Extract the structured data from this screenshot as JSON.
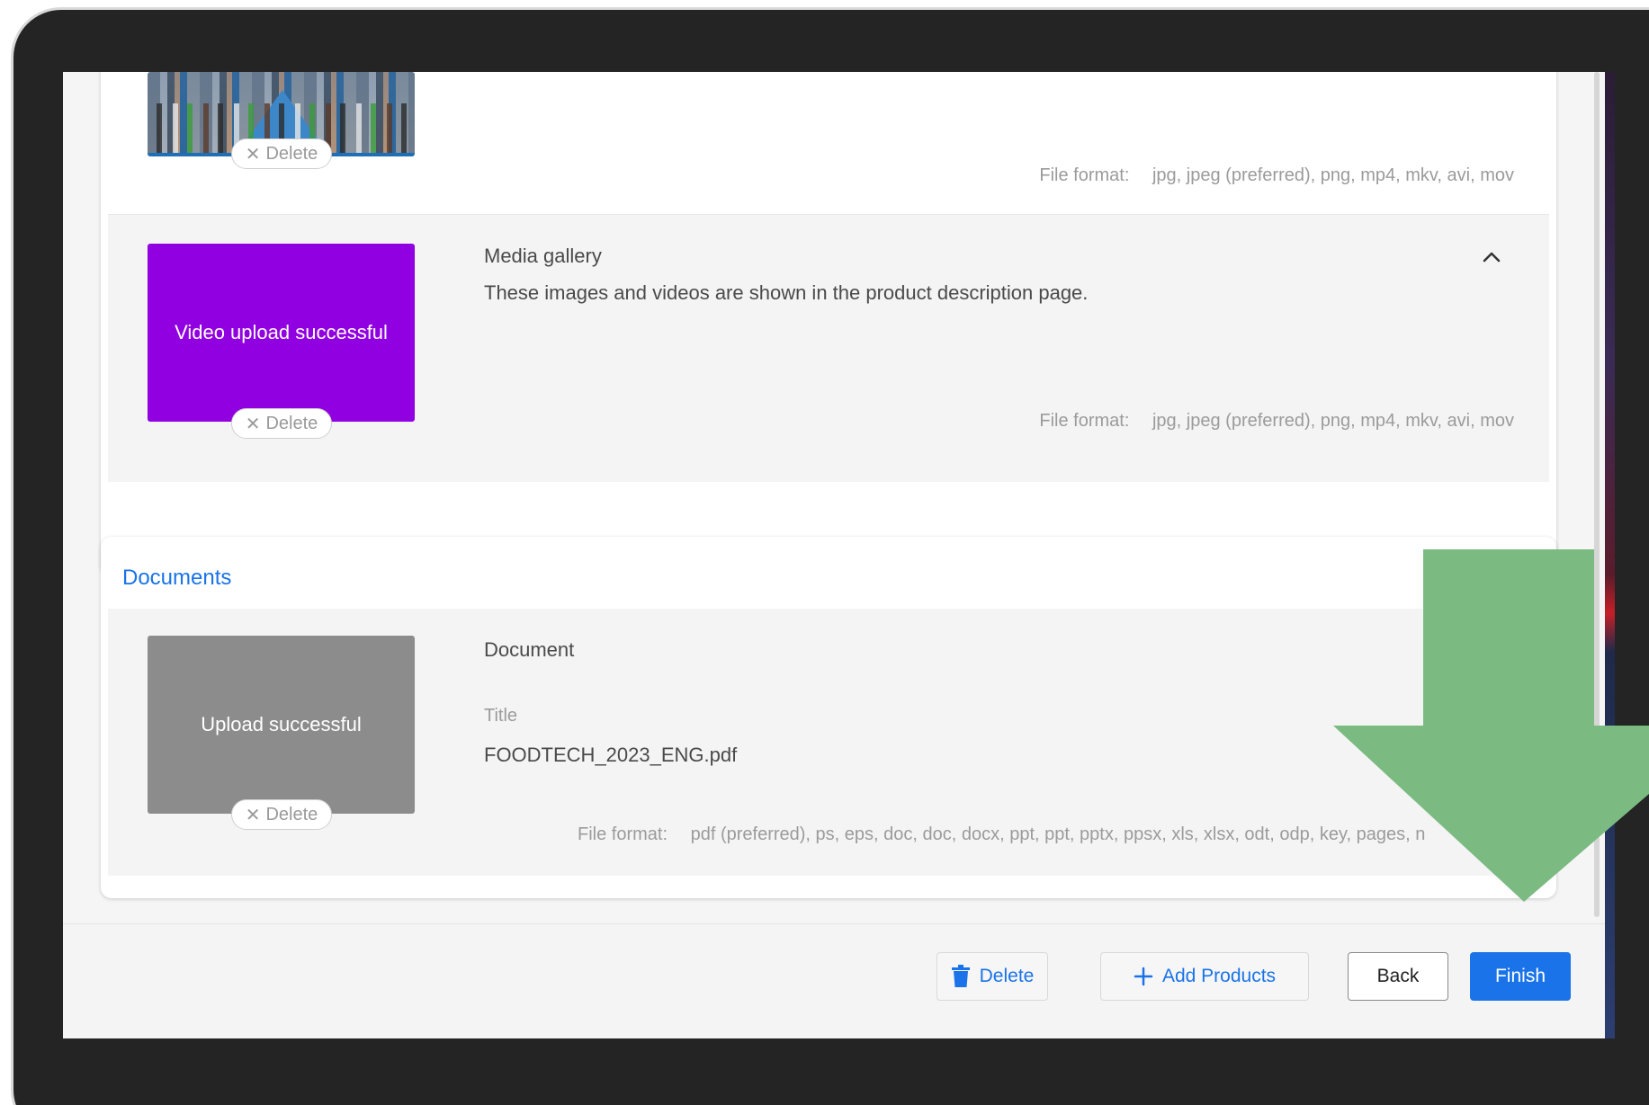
{
  "media": {
    "row1": {
      "delete_label": "Delete",
      "file_format_label": "File format:",
      "file_format_value": "jpg, jpeg (preferred), png, mp4, mkv, avi, mov"
    },
    "gallery": {
      "title": "Media gallery",
      "description": "These images and videos are shown in the product description page.",
      "thumb_text": "Video upload successful",
      "delete_label": "Delete",
      "file_format_label": "File format:",
      "file_format_value": "jpg, jpeg (preferred), png, mp4, mkv, avi, mov"
    }
  },
  "documents": {
    "header": "Documents",
    "item": {
      "title": "Document",
      "thumb_text": "Upload successful",
      "delete_label": "Delete",
      "title_label": "Title",
      "filename": "FOODTECH_2023_ENG.pdf",
      "file_format_label": "File format:",
      "file_format_value": "pdf (preferred), ps, eps, doc, doc, docx, ppt, ppt, pptx, ppsx, xls, xlsx, odt, odp, key, pages, n"
    }
  },
  "footer": {
    "delete_label": "Delete",
    "add_products_label": "Add Products",
    "back_label": "Back",
    "finish_label": "Finish"
  },
  "colors": {
    "accent": "#1a73e8",
    "video_thumb": "#9000e0",
    "doc_thumb": "#8c8c8c",
    "arrow": "#7bbb82",
    "device_frame": "#242424"
  },
  "icons": {
    "trash": "trash-icon",
    "plus": "plus-icon",
    "chevron": "chevron-up-icon",
    "close": "close-icon",
    "arrow": "down-arrow-icon"
  }
}
